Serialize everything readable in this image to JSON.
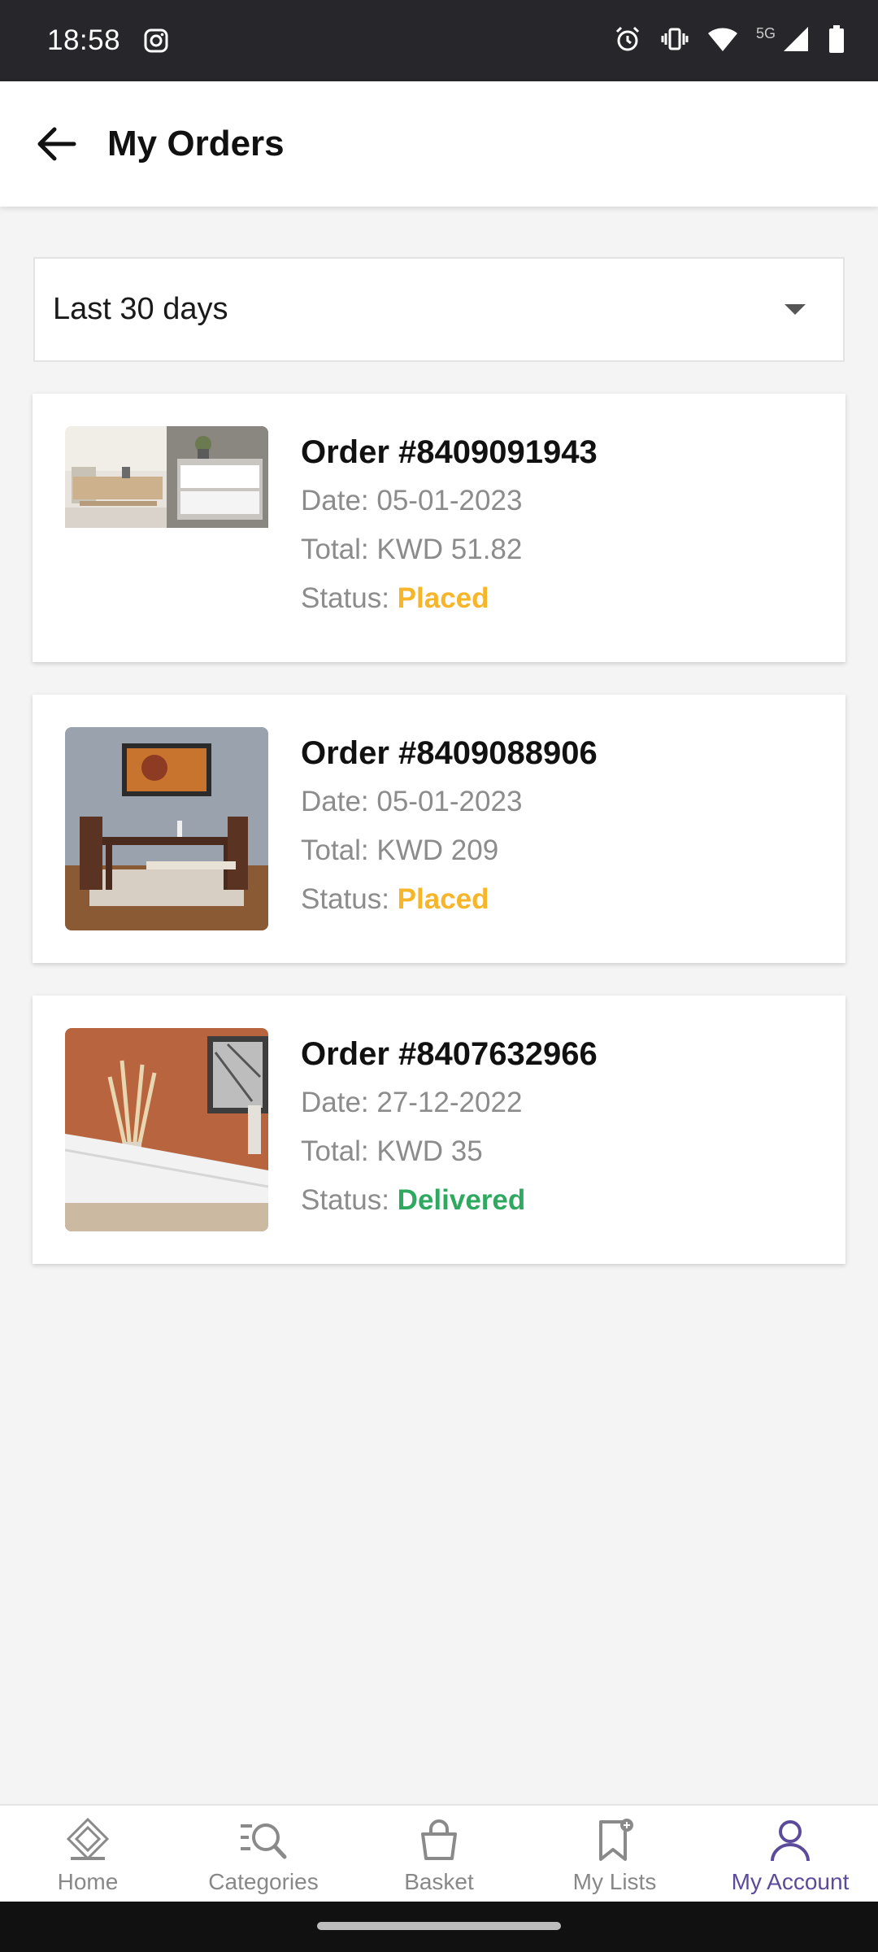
{
  "status_bar": {
    "time": "18:58",
    "network": "5G"
  },
  "header": {
    "title": "My Orders"
  },
  "filter": {
    "selected": "Last 30 days"
  },
  "orders": [
    {
      "title": "Order  #8409091943",
      "date_label": "Date: 05-01-2023",
      "total_label": "Total: KWD 51.82",
      "status_prefix": "Status: ",
      "status": "Placed",
      "status_color": "#f7b52a"
    },
    {
      "title": "Order  #8409088906",
      "date_label": "Date: 05-01-2023",
      "total_label": "Total: KWD 209",
      "status_prefix": "Status: ",
      "status": "Placed",
      "status_color": "#f7b52a"
    },
    {
      "title": "Order  #8407632966",
      "date_label": "Date: 27-12-2022",
      "total_label": "Total: KWD 35",
      "status_prefix": "Status: ",
      "status": "Delivered",
      "status_color": "#2fa860"
    }
  ],
  "bottom_nav": {
    "items": [
      {
        "label": "Home",
        "icon": "home-logo-icon"
      },
      {
        "label": "Categories",
        "icon": "categories-search-icon"
      },
      {
        "label": "Basket",
        "icon": "basket-icon"
      },
      {
        "label": "My Lists",
        "icon": "bookmark-icon"
      },
      {
        "label": "My Account",
        "icon": "account-icon"
      }
    ],
    "active": "My Account",
    "active_color": "#5c4b9a"
  }
}
